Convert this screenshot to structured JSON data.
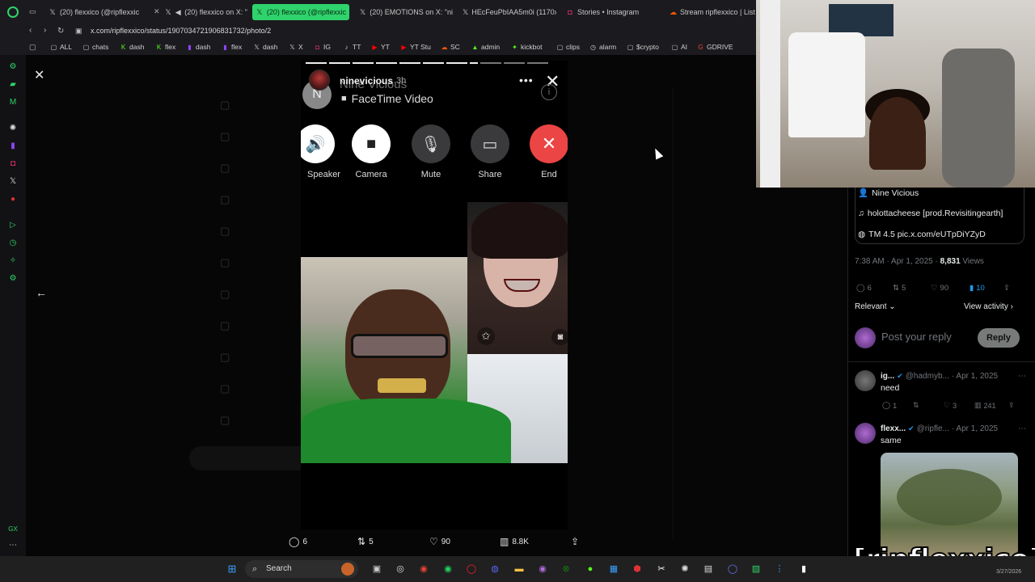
{
  "browser": {
    "tabs": [
      {
        "label": "(20) flexxico (@ripflexxic",
        "icon": "x-logo",
        "active": false
      },
      {
        "label": "(20) flexxico on X: \"",
        "icon": "x-logo",
        "active": false
      },
      {
        "label": "(20) flexxico (@ripflexxic",
        "icon": "x-logo",
        "active": true
      },
      {
        "label": "(20) EMOTIONS on X: \"ni",
        "icon": "x-logo",
        "active": false
      },
      {
        "label": "HEcFeuPbIAA5m0i (1170x",
        "icon": "x-logo",
        "active": false
      },
      {
        "label": "Stories • Instagram",
        "icon": "instagram-logo",
        "active": false
      },
      {
        "label": "Stream ripflexxico | Liste",
        "icon": "soundcloud-logo",
        "active": false
      }
    ],
    "url": "x.com/ripflexxico/status/1907034721906831732/photo/2",
    "bookmarks": [
      "ALL",
      "chats",
      "dash",
      "flex",
      "dash",
      "flex",
      "dash",
      "X",
      "IG",
      "TT",
      "YT",
      "YT Stu",
      "SC",
      "admin",
      "kickbot",
      "clips",
      "alarm",
      "$crypto",
      "AI",
      "GDRIVE"
    ]
  },
  "story": {
    "username": "ninevicious",
    "time": "3h",
    "contact_name": "Nine Vicious",
    "avatar_letter": "N",
    "call_type": "FaceTime Video",
    "controls": [
      {
        "label": "Speaker",
        "icon": "speaker-icon"
      },
      {
        "label": "Camera",
        "icon": "camera-icon"
      },
      {
        "label": "Mute",
        "icon": "mute-icon"
      },
      {
        "label": "Share",
        "icon": "share-screen-icon"
      },
      {
        "label": "End",
        "icon": "end-call-icon"
      }
    ],
    "info_badge": "i"
  },
  "viewer_actions": {
    "replies": "6",
    "reposts": "5",
    "likes": "90",
    "views": "8.8K"
  },
  "tweet": {
    "lines": [
      {
        "icon": "person",
        "text": "Nine Vicious"
      },
      {
        "icon": "music-note",
        "text": "holottacheese [prod.Revisitingearth]"
      },
      {
        "icon": "tm",
        "text": "TM 4.5 pic.x.com/eUTpDiYZyD"
      }
    ],
    "time": "7:38 AM · Apr 1, 2025 · ",
    "views_count": "8,831",
    "views_label": " Views",
    "stats": {
      "replies": "6",
      "reposts": "5",
      "likes": "90",
      "bookmarks": "10"
    },
    "sort_label": "Relevant",
    "view_activity": "View activity",
    "reply_placeholder": "Post your reply",
    "reply_button": "Reply"
  },
  "replies": [
    {
      "name": "ig...",
      "handle": "@hadmyb...",
      "date": "· Apr 1, 2025",
      "text": "need",
      "stats": {
        "replies": "1",
        "likes": "3",
        "views": "241"
      }
    },
    {
      "name": "flexx...",
      "handle": "@ripfle...",
      "date": "· Apr 1, 2025",
      "text": "same"
    }
  ],
  "watermark": "[ripflexxico]",
  "taskbar": {
    "search_label": "Search",
    "date": "3/27/2026"
  },
  "colors": {
    "accent": "#2fd36b",
    "x_blue": "#1d9bf0",
    "end_red": "#eb4545"
  }
}
